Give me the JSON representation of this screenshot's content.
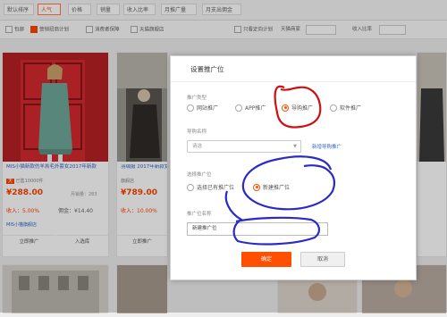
{
  "sort_tabs": [
    "默认排序",
    "人气",
    "价格",
    "销量",
    "收入比率",
    "月推广量",
    "月支出佣金"
  ],
  "active_sort": "人气",
  "filters": {
    "options": [
      "包邮",
      "营销招商计划",
      "消费者保障",
      "天猫旗舰店",
      "只看定向计划",
      "天猫商家"
    ],
    "checked": "营销招商计划",
    "search_label": "收入比率"
  },
  "products": [
    {
      "title": "MIS小猫新款仿羊羔毛外套女2017年新款",
      "shop": "已售10000件",
      "price": "¥288.00",
      "sold": "月销量：283",
      "rate": "收入：5.00%",
      "comm": "佣金：¥14.40",
      "shop2": "MIS小猫旗舰店",
      "action": "立即推广",
      "action2": "入选库"
    },
    {
      "title": "羽绒服 2017年新款女装中长款",
      "shop": "旗舰店",
      "price": "¥789.00",
      "sold": "月销量：",
      "rate": "收入：10.00%",
      "comm": "佣金：",
      "shop2": "",
      "action": "立即推广",
      "action2": ""
    },
    {
      "title": "",
      "shop": "",
      "price": "",
      "sold": "",
      "rate": "",
      "comm": "",
      "shop2": "",
      "action": "",
      "action2": ""
    }
  ],
  "modal": {
    "title": "设置推广位",
    "promo_type_label": "推广类型",
    "promo_types": [
      "网站推广",
      "APP推广",
      "导购推广",
      "软件推广"
    ],
    "promo_type_selected": "导购推广",
    "guide_name_label": "导购名称",
    "guide_select_value": "请选",
    "new_guide_link": "新增导购推广",
    "slot_choice_label": "选择推广位",
    "slot_choices": [
      "选择已有推广位",
      "新建推广位"
    ],
    "slot_choice_selected": "新建推广位",
    "slot_name_label": "推广位名称",
    "slot_name_value": "新建推广位",
    "confirm": "确定",
    "cancel": "取消"
  },
  "colors": {
    "accent": "#ff5000",
    "link": "#3366cc",
    "annotation_red": "#d01010",
    "annotation_blue": "#2a2ac8"
  }
}
